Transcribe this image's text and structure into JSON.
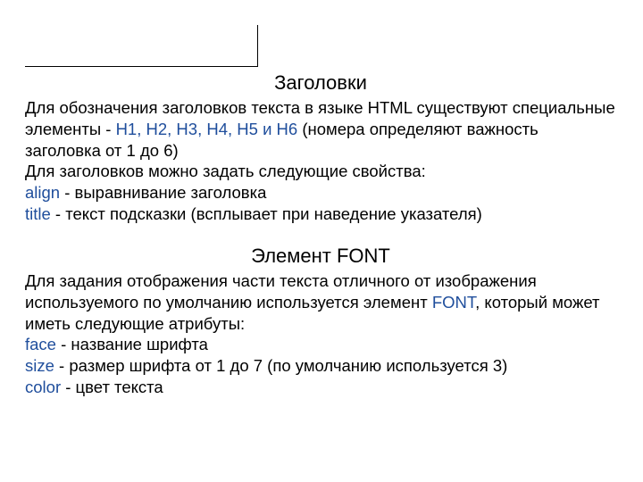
{
  "section1": {
    "heading": "Заголовки",
    "line1a": "Для обозначения заголовков текста в языке HTML существуют специальные элементы - ",
    "headings_kw": "H1, H2, H3, H4, H5 и H6",
    "line1b": " (номера определяют важность заголовка от 1 до 6)",
    "line2": "Для заголовков можно задать следующие свойства:",
    "align_kw": "align",
    "align_desc": " - выравнивание заголовка",
    "title_kw": "title",
    "title_desc": " - текст подсказки (всплывает при наведение указателя)"
  },
  "section2": {
    "heading": "Элемент FONT",
    "line1a": "Для задания отображения части текста отличного от изображения используемого по умолчанию используется элемент ",
    "font_kw": "FONT",
    "line1b": ", который может иметь следующие атрибуты:",
    "face_kw": "face",
    "face_desc": " - название шрифта",
    "size_kw": "size",
    "size_desc": " - размер шрифта от 1 до 7 (по умолчанию используется 3)",
    "color_kw": "color",
    "color_desc": " - цвет текста"
  }
}
